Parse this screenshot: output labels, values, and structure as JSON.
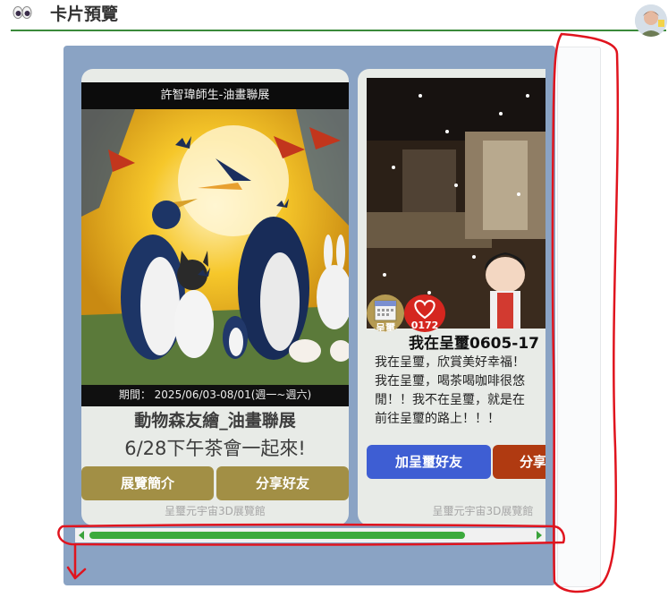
{
  "header": {
    "icon": "eyes-icon",
    "title": "卡片預覽"
  },
  "cards": [
    {
      "poster_top_text": "許智瑋師生-油畫聯展",
      "poster_period": "期間： 2025/06/03-08/01(週一~週六)",
      "title": "動物森友繪_油畫聯展",
      "subtitle": "6/28下午茶會一起來!",
      "buttons": [
        "展覽簡介",
        "分享好友"
      ],
      "footer": "呈璽元宇宙3D展覽館"
    },
    {
      "calendar_badge_label": "呈璽",
      "like_count": "0172",
      "title": "我在呈璽0605-17",
      "body_lines": [
        "我在呈璽，欣賞美好幸福！",
        "我在呈璽，喝茶喝咖啡很悠",
        "閒！！我不在呈璽，就是在",
        "前往呈璽的路上！！！"
      ],
      "buttons": [
        "加呈璽好友",
        "分享"
      ],
      "footer": "呈璽元宇宙3D展覽館"
    }
  ],
  "scrollbar": {
    "position_fraction": 0.0,
    "visible_fraction": 0.85
  },
  "colors": {
    "accent_green": "#3caa3c",
    "panel_blue": "#8aa3c4",
    "button_brown": "#a28f45",
    "button_blue": "#3e5ed3",
    "button_red": "#b03a11",
    "annotation_red": "#e0141e"
  }
}
